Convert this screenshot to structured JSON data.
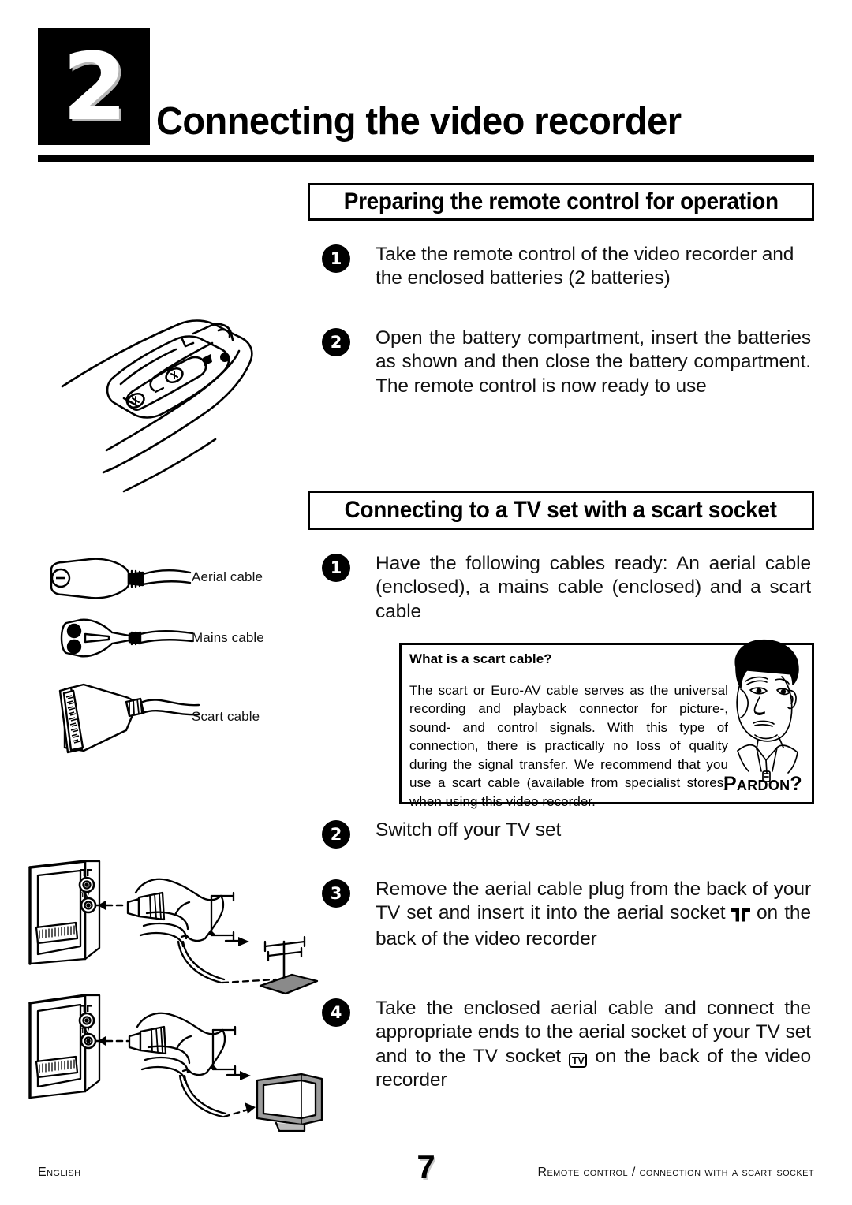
{
  "header": {
    "chapter_number": "2",
    "chapter_title": "Connecting the video recorder"
  },
  "sections": [
    {
      "id": "remote-control",
      "title": "Preparing the remote control for operation",
      "steps": [
        {
          "number": "1",
          "text": "Take the remote control of the video recorder and the enclosed batteries (2 batteries)"
        },
        {
          "number": "2",
          "text": "Open the battery compartment, insert the batteries as shown and then close the battery compartment. The remote control is now ready to use"
        }
      ]
    },
    {
      "id": "scart-socket",
      "title": "Connecting to a TV set with a scart socket",
      "steps": [
        {
          "number": "1",
          "text": "Have the following cables ready: An aerial cable (enclosed), a mains cable (enclosed) and a scart cable"
        },
        {
          "number": "2",
          "text": "Switch off your TV set"
        },
        {
          "number": "3",
          "text_before": "Remove the aerial cable plug from the back of your TV set and insert it into the aerial socket",
          "icon": "aerial-socket-icon",
          "text_after": "on the back of the video recorder"
        },
        {
          "number": "4",
          "text_before": "Take the enclosed aerial cable and connect the appropriate ends to the aerial socket of your TV set and to the TV socket",
          "icon": "tv-socket-icon",
          "icon_label": "TV",
          "text_after": "on the back of the video recorder"
        }
      ]
    }
  ],
  "cable_labels": [
    {
      "id": "aerial",
      "label": "Aerial cable"
    },
    {
      "id": "mains",
      "label": "Mains cable"
    },
    {
      "id": "scart",
      "label": "Scart cable"
    }
  ],
  "info_box": {
    "title": "What is a scart cable?",
    "body": "The scart or Euro-AV cable serves as the universal recording and playback connector for picture-, sound- and control signals. With this type of connection, there is practically no loss of quality during the signal transfer. We recommend that you use a scart cable (available from specialist stores) when using this video recorder.",
    "mascot_caption": "Pardon?"
  },
  "tv_panel_labels": {
    "aerial": "aerial-socket-symbol",
    "tv": "TV"
  },
  "footer": {
    "language": "English",
    "page_number": "7",
    "reference": "Remote control / connection with a scart socket"
  },
  "colors": {
    "ink": "#000000",
    "paper": "#ffffff",
    "shadow": "#bdbdbd"
  }
}
